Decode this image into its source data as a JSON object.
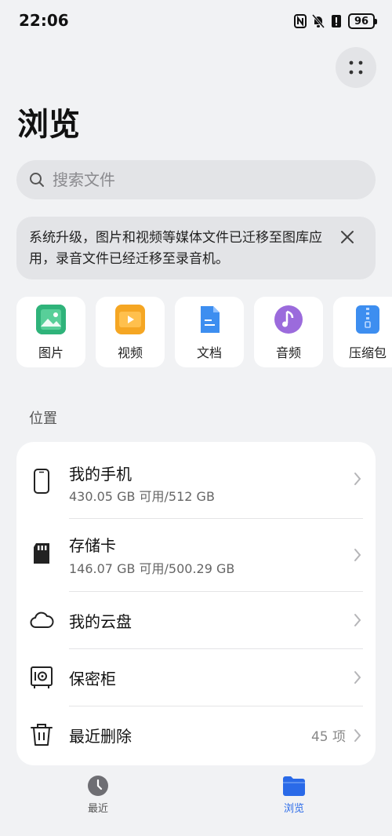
{
  "status": {
    "time": "22:06",
    "battery": "96"
  },
  "header": {
    "title": "浏览"
  },
  "search": {
    "placeholder": "搜索文件"
  },
  "notice": {
    "text": "系统升级，图片和视频等媒体文件已迁移至图库应用，录音文件已经迁移至录音机。"
  },
  "categories": [
    {
      "label": "图片",
      "icon": "image-icon",
      "color": "#2fb37a"
    },
    {
      "label": "视频",
      "icon": "video-icon",
      "color": "#f5a623"
    },
    {
      "label": "文档",
      "icon": "document-icon",
      "color": "#3d8ef0"
    },
    {
      "label": "音频",
      "icon": "music-icon",
      "color": "#9b6bdc"
    },
    {
      "label": "压缩包",
      "icon": "zip-icon",
      "color": "#3d8ef0"
    }
  ],
  "locations": {
    "title": "位置",
    "items": [
      {
        "name": "我的手机",
        "sub": "430.05 GB 可用/512 GB",
        "icon": "phone-icon"
      },
      {
        "name": "存储卡",
        "sub": "146.07 GB 可用/500.29 GB",
        "icon": "sd-card-icon"
      },
      {
        "name": "我的云盘",
        "icon": "cloud-icon"
      },
      {
        "name": "保密柜",
        "icon": "safe-icon"
      },
      {
        "name": "最近删除",
        "count": "45 项",
        "icon": "trash-icon"
      }
    ]
  },
  "tabs": [
    {
      "label": "最近",
      "icon": "clock-icon"
    },
    {
      "label": "浏览",
      "icon": "folder-icon"
    }
  ],
  "colors": {
    "accent": "#2a6ae8",
    "background": "#f1f2f4"
  }
}
